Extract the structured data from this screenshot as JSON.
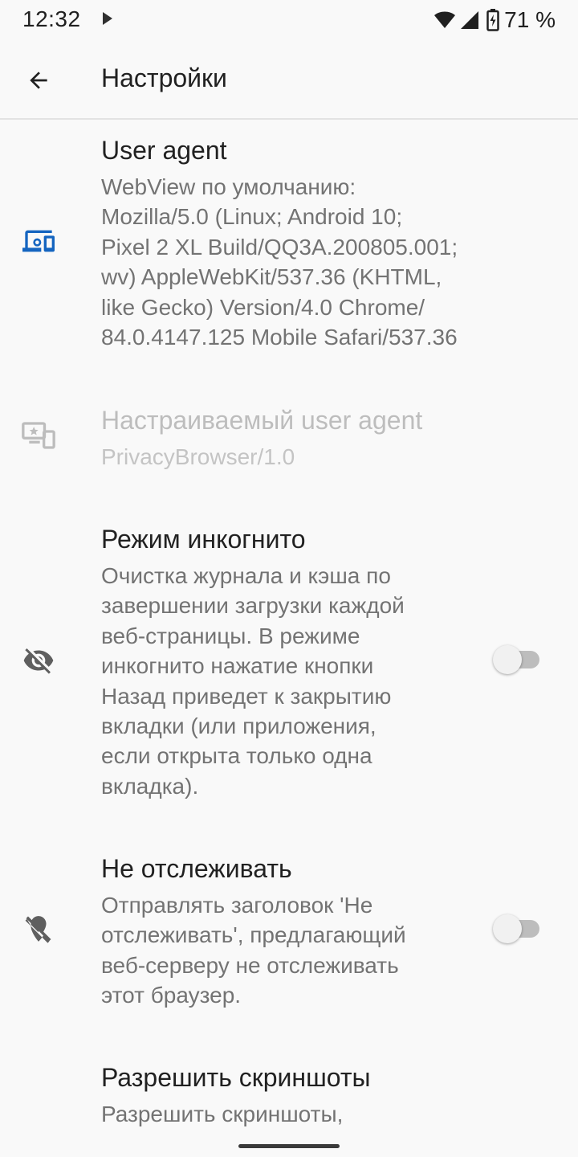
{
  "status_bar": {
    "time": "12:32",
    "battery": "71 %",
    "icons": [
      "play-icon",
      "wifi-icon",
      "signal-icon",
      "battery-icon"
    ]
  },
  "app_bar": {
    "title": "Настройки",
    "back_icon": "arrow-back-icon"
  },
  "colors": {
    "accent": "#1565c0",
    "icon": "#5f5f5f",
    "disabled": "#bdbdbd"
  },
  "preferences": [
    {
      "icon": "devices-icon",
      "title": "User agent",
      "summary": "WebView по умолчанию:\nMozilla/5.0 (Linux; Android 10;\nPixel 2 XL Build/QQ3A.200805.001;\nwv) AppleWebKit/537.36 (KHTML,\nlike Gecko) Version/4.0 Chrome/\n84.0.4147.125 Mobile Safari/537.36",
      "enabled": true
    },
    {
      "icon": "custom-devices-icon",
      "title": "Настраиваемый user agent",
      "summary": "PrivacyBrowser/1.0",
      "enabled": false
    },
    {
      "icon": "visibility-off-icon",
      "title": "Режим инкогнито",
      "summary": "Очистка журнала и кэша по\nзавершении загрузки каждой\nвеб-страницы. В режиме\nинкогнито нажатие кнопки\nНазад приведет к закрытию\nвкладки (или приложения,\nесли открыта только одна\nвкладка).",
      "switch_on": false
    },
    {
      "icon": "location-off-icon",
      "title": "Не отслеживать",
      "summary": "Отправлять заголовок 'Не\nотслеживать', предлагающий\nвеб-серверу не отслеживать\nэтот браузер.",
      "switch_on": false
    },
    {
      "title": "Разрешить скриншоты",
      "summary": "Разрешить скриншоты,"
    }
  ]
}
